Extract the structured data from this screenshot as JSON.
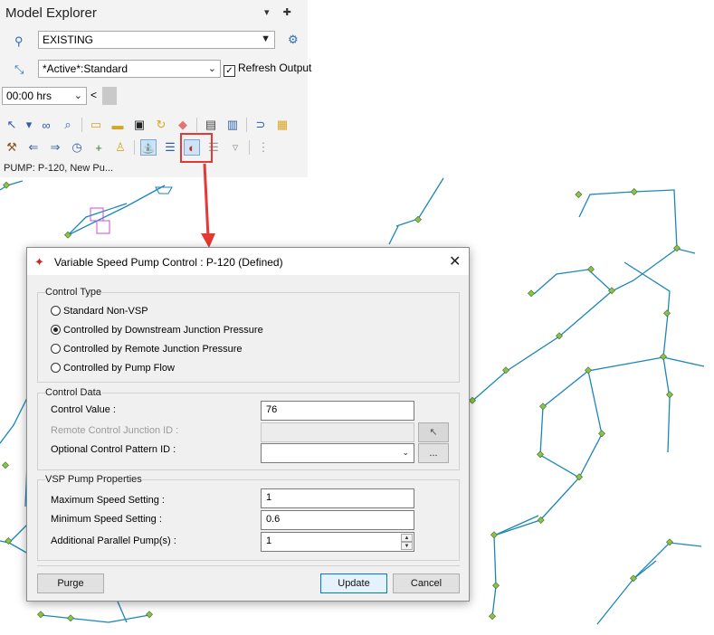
{
  "explorer": {
    "title": "Model Explorer",
    "title_buttons": "▾ ✚",
    "scenario": "EXISTING",
    "active_standard": "*Active*:Standard",
    "refresh_label": "Refresh Output",
    "time": "00:00 hrs",
    "status_text": "PUMP: P-120, New Pu..."
  },
  "toolbar_icons": {
    "row1": [
      "select-arrow-icon",
      "dropdown-caret-icon",
      "binoculars-icon",
      "zoom-icon",
      "open-folder-icon",
      "folder-icon",
      "save-icon",
      "refresh-icon",
      "eraser-icon",
      "report-icon",
      "chart-icon",
      "link-icon",
      "folder-chart-icon"
    ],
    "row2": [
      "hammer-icon",
      "back-arrow-icon",
      "forward-arrow-icon",
      "clock-icon",
      "add-id-icon",
      "person-icon",
      "pump-icon",
      "sliders-icon",
      "vsp-pump-control-icon",
      "fire-flow-icon",
      "valve-icon",
      "tank-icon"
    ]
  },
  "dialog": {
    "title": "Variable Speed Pump Control :  P-120 (Defined)",
    "close_glyph": "✕",
    "control_type": {
      "label": "Control Type",
      "options": [
        {
          "label": "Standard Non-VSP",
          "selected": false
        },
        {
          "label": "Controlled by Downstream Junction Pressure",
          "selected": true
        },
        {
          "label": "Controlled by Remote Junction Pressure",
          "selected": false
        },
        {
          "label": "Controlled by Pump Flow",
          "selected": false
        }
      ]
    },
    "control_data": {
      "label": "Control Data",
      "control_value_label": "Control Value :",
      "control_value": "76",
      "remote_junction_label": "Remote Control Junction ID :",
      "remote_junction_value": "",
      "pattern_label": "Optional Control Pattern ID :",
      "pattern_value": "",
      "ellipsis": "..."
    },
    "vsp_properties": {
      "label": "VSP Pump Properties",
      "max_speed_label": "Maximum Speed Setting :",
      "max_speed_value": "1",
      "min_speed_label": "Minimum Speed Setting :",
      "min_speed_value": "0.6",
      "parallel_label": "Additional Parallel Pump(s) :",
      "parallel_value": "1"
    },
    "buttons": {
      "purge": "Purge",
      "update": "Update",
      "cancel": "Cancel"
    }
  },
  "colors": {
    "pipe": "#1b86b8",
    "node": "#8bc34a",
    "highlight": "#e53935"
  }
}
